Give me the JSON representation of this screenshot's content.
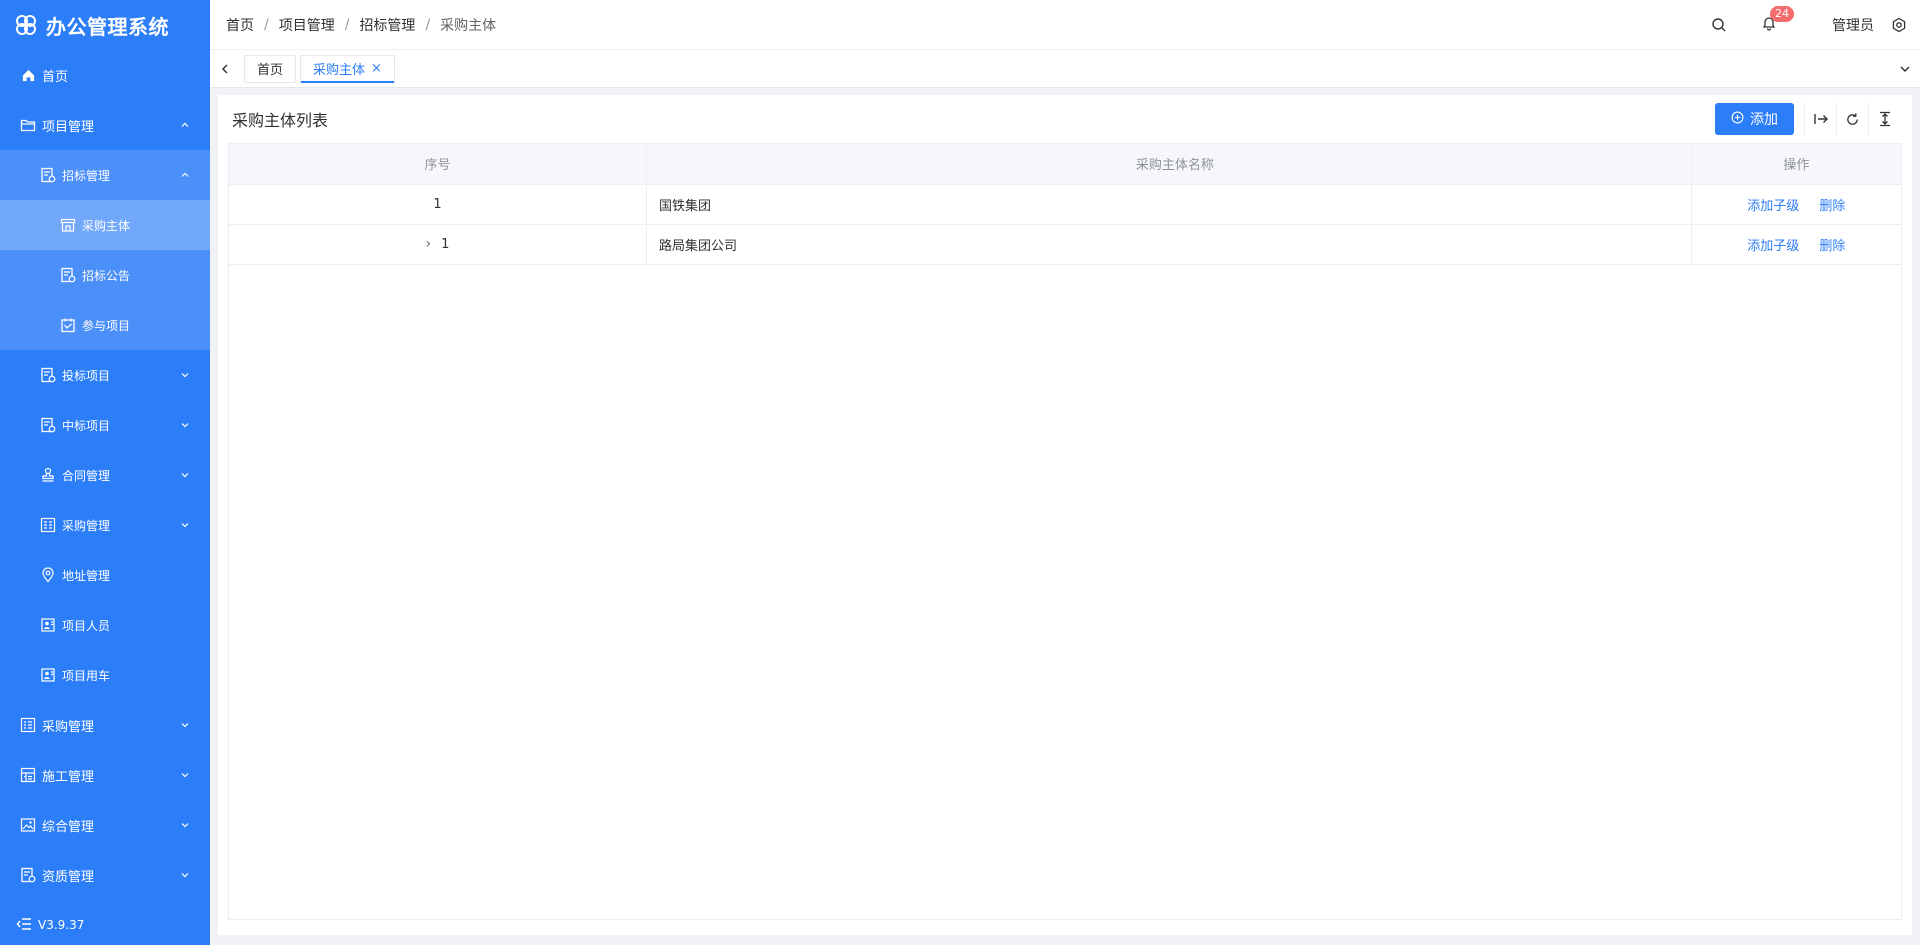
{
  "app": {
    "title": "办公管理系统",
    "version": "V3.9.37"
  },
  "colors": {
    "primary": "#2c7ef8",
    "sidebar_sub": "#4b8ff9",
    "sidebar_active": "#72a8fb",
    "badge": "#f56c6c"
  },
  "sidebar": {
    "items": [
      {
        "label": "首页",
        "icon": "home-icon"
      },
      {
        "label": "项目管理",
        "icon": "folder-icon",
        "expanded": true
      },
      {
        "label": "招标管理",
        "icon": "doc-gear-icon",
        "expanded": true
      },
      {
        "label": "采购主体",
        "icon": "store-icon",
        "active": true
      },
      {
        "label": "招标公告",
        "icon": "doc-gear-icon"
      },
      {
        "label": "参与项目",
        "icon": "calendar-icon"
      },
      {
        "label": "投标项目",
        "icon": "doc-gear-icon"
      },
      {
        "label": "中标项目",
        "icon": "doc-gear-icon"
      },
      {
        "label": "合同管理",
        "icon": "stamp-icon"
      },
      {
        "label": "采购管理",
        "icon": "grid-icon"
      },
      {
        "label": "地址管理",
        "icon": "location-icon"
      },
      {
        "label": "项目人员",
        "icon": "person-card-icon"
      },
      {
        "label": "项目用车",
        "icon": "person-card-icon"
      },
      {
        "label": "采购管理",
        "icon": "list-icon"
      },
      {
        "label": "施工管理",
        "icon": "table-icon"
      },
      {
        "label": "综合管理",
        "icon": "image-icon"
      },
      {
        "label": "资质管理",
        "icon": "doc-gear-icon"
      }
    ]
  },
  "header": {
    "breadcrumb": [
      "首页",
      "项目管理",
      "招标管理",
      "采购主体"
    ],
    "separator": "/",
    "notifications": "24",
    "username": "管理员"
  },
  "tabs": {
    "items": [
      {
        "label": "首页"
      },
      {
        "label": "采购主体",
        "close": "×"
      }
    ]
  },
  "main": {
    "title": "采购主体列表",
    "add_label": "添加",
    "columns": [
      "序号",
      "采购主体名称",
      "操作"
    ],
    "rows": [
      {
        "index": "1",
        "name": "国铁集团",
        "add_child": "添加子级",
        "delete": "删除"
      },
      {
        "index": "1",
        "name": "路局集团公司",
        "add_child": "添加子级",
        "delete": "删除",
        "expand": "›"
      }
    ]
  }
}
